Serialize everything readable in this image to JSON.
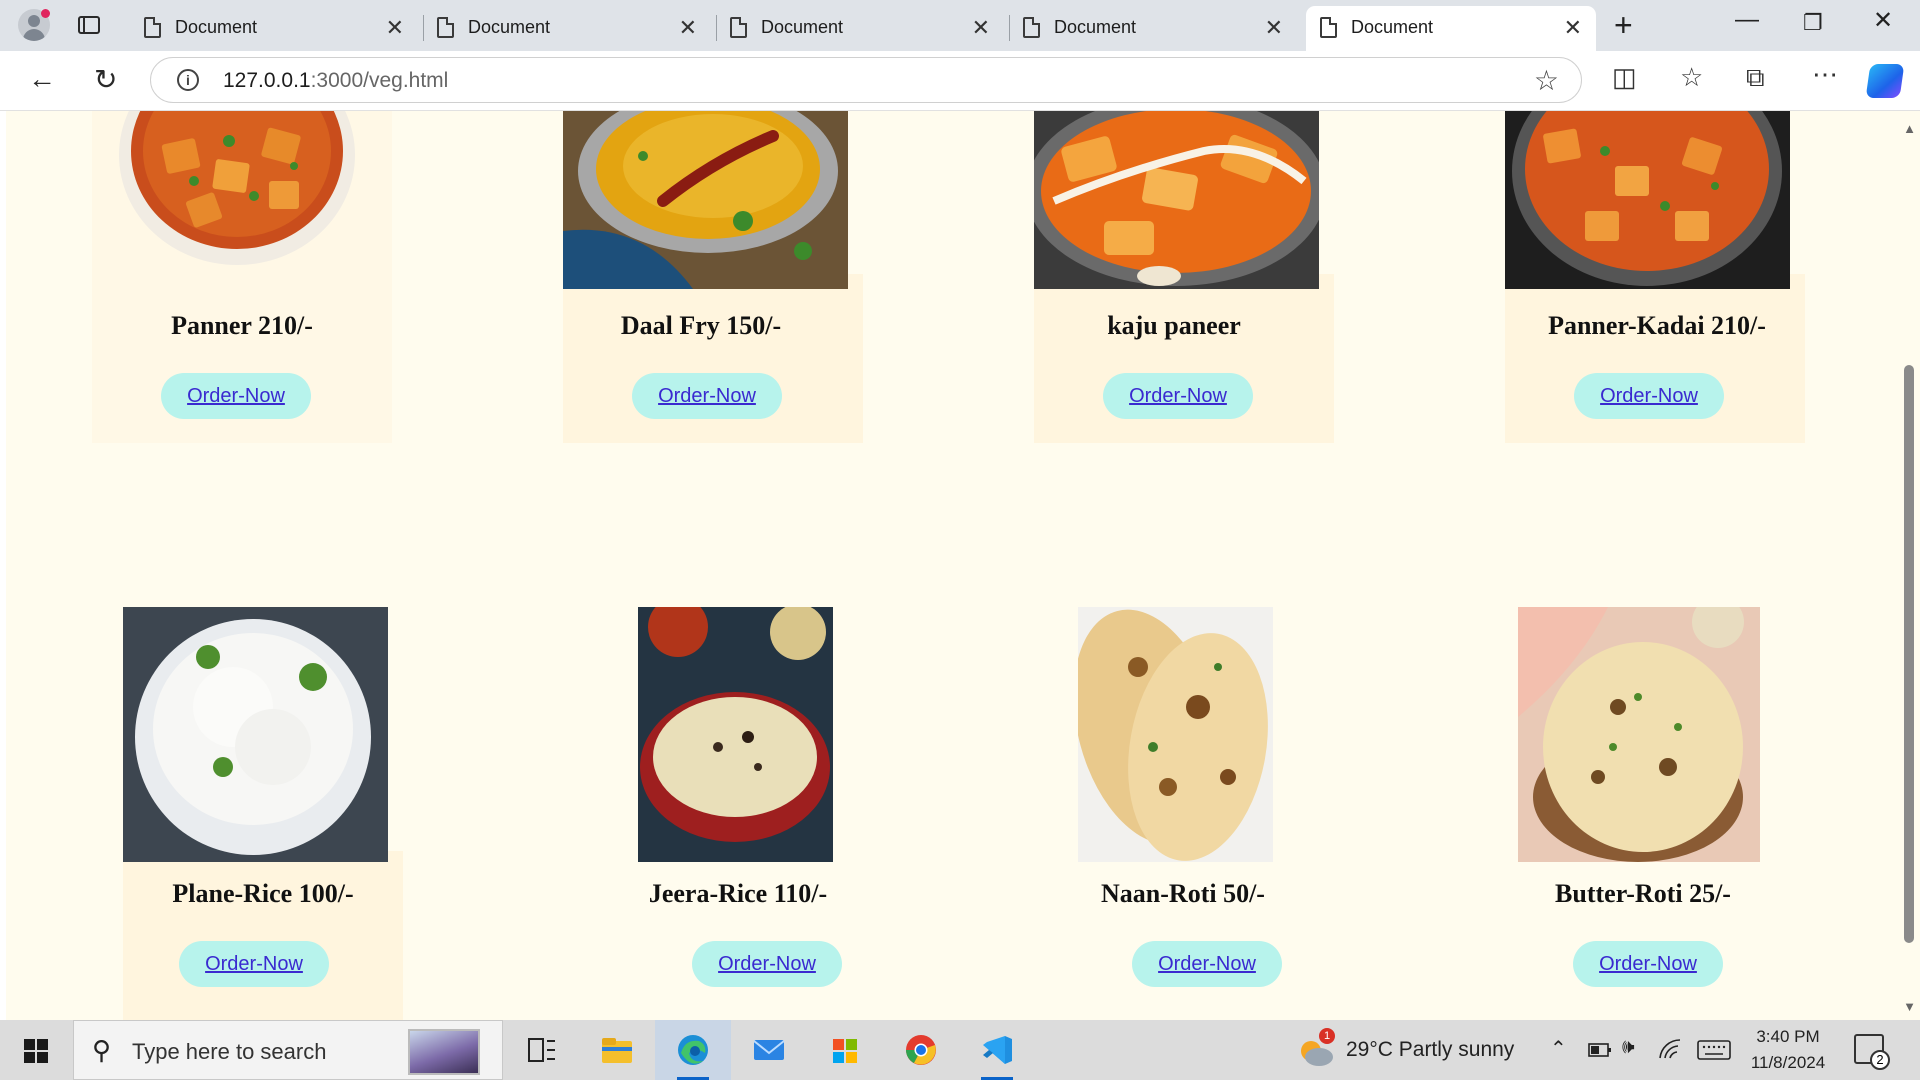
{
  "browser": {
    "tabs": [
      {
        "title": "Document",
        "active": false
      },
      {
        "title": "Document",
        "active": false
      },
      {
        "title": "Document",
        "active": false
      },
      {
        "title": "Document",
        "active": false
      },
      {
        "title": "Document",
        "active": true
      }
    ],
    "close_glyph": "✕",
    "new_tab_glyph": "+",
    "window_buttons": {
      "minimize": "—",
      "restore": "❐",
      "close": "✕"
    },
    "url_host": "127.0.0.1",
    "url_path": ":3000/veg.html"
  },
  "menu_items": [
    {
      "name": "Panner 210/-",
      "button": "Order-Now",
      "image": "paneer-curry"
    },
    {
      "name": "Daal Fry 150/-",
      "button": "Order-Now",
      "image": "dal-fry"
    },
    {
      "name": "kaju paneer",
      "button": "Order-Now",
      "image": "kaju-paneer"
    },
    {
      "name": "Panner-Kadai 210/-",
      "button": "Order-Now",
      "image": "kadai-paneer"
    },
    {
      "name": "Plane-Rice 100/-",
      "button": "Order-Now",
      "image": "plain-rice"
    },
    {
      "name": "Jeera-Rice 110/-",
      "button": "Order-Now",
      "image": "jeera-rice"
    },
    {
      "name": "Naan-Roti 50/-",
      "button": "Order-Now",
      "image": "naan"
    },
    {
      "name": "Butter-Roti 25/-",
      "button": "Order-Now",
      "image": "butter-naan"
    }
  ],
  "taskbar": {
    "search_placeholder": "Type here to search",
    "weather": "29°C  Partly sunny",
    "weather_badge": "1",
    "time": "3:40 PM",
    "date": "11/8/2024",
    "notification_count": "2"
  },
  "colors": {
    "page_bg": "#fffcee",
    "card_bg": "#fff5de",
    "button_bg": "#b7f3ec",
    "link": "#3a2ad0"
  }
}
